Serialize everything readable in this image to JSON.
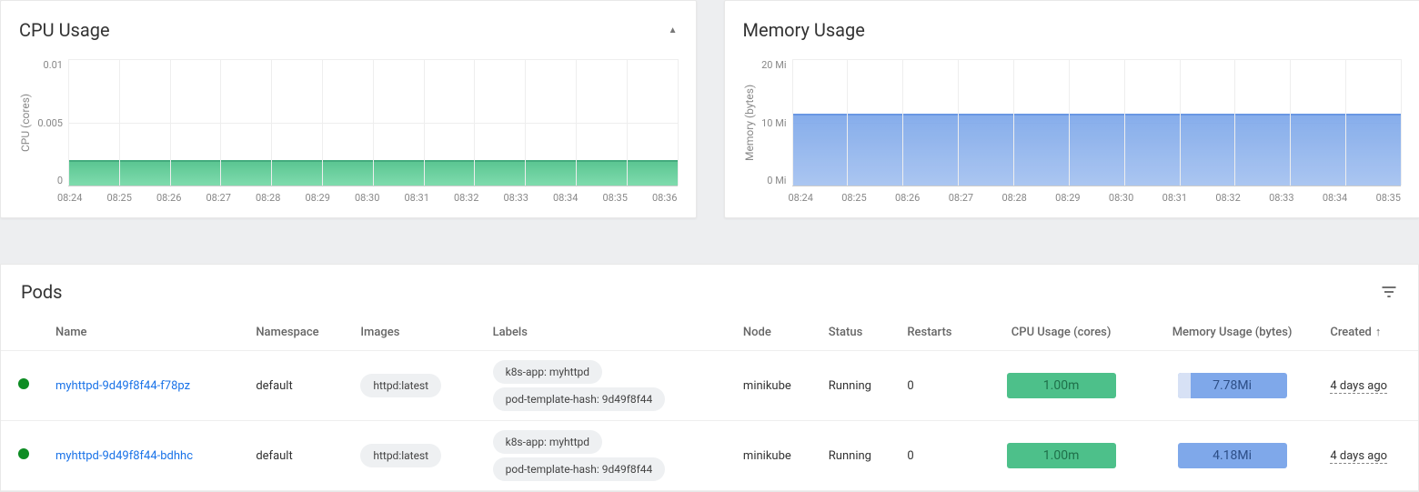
{
  "cpu_chart": {
    "title": "CPU Usage",
    "ylabel": "CPU (cores)",
    "yticks": [
      "0.01",
      "0.005",
      "0"
    ],
    "xticks": [
      "08:24",
      "08:25",
      "08:26",
      "08:27",
      "08:28",
      "08:29",
      "08:30",
      "08:31",
      "08:32",
      "08:33",
      "08:34",
      "08:35",
      "08:36"
    ]
  },
  "mem_chart": {
    "title": "Memory Usage",
    "ylabel": "Memory (bytes)",
    "yticks": [
      "20 Mi",
      "10 Mi",
      "0 Mi"
    ],
    "xticks": [
      "08:24",
      "08:25",
      "08:26",
      "08:27",
      "08:28",
      "08:29",
      "08:30",
      "08:31",
      "08:32",
      "08:33",
      "08:34",
      "08:35"
    ]
  },
  "chart_data": [
    {
      "type": "area",
      "title": "CPU Usage",
      "xlabel": "",
      "ylabel": "CPU (cores)",
      "ylim": [
        0,
        0.01
      ],
      "x": [
        "08:24",
        "08:25",
        "08:26",
        "08:27",
        "08:28",
        "08:29",
        "08:30",
        "08:31",
        "08:32",
        "08:33",
        "08:34",
        "08:35",
        "08:36"
      ],
      "series": [
        {
          "name": "CPU",
          "values": [
            0.002,
            0.002,
            0.002,
            0.002,
            0.002,
            0.002,
            0.002,
            0.002,
            0.002,
            0.002,
            0.002,
            0.002,
            0.002
          ]
        }
      ]
    },
    {
      "type": "area",
      "title": "Memory Usage",
      "xlabel": "",
      "ylabel": "Memory (bytes)",
      "ylim": [
        0,
        20
      ],
      "y_unit": "Mi",
      "x": [
        "08:24",
        "08:25",
        "08:26",
        "08:27",
        "08:28",
        "08:29",
        "08:30",
        "08:31",
        "08:32",
        "08:33",
        "08:34",
        "08:35"
      ],
      "series": [
        {
          "name": "Memory",
          "values": [
            12,
            12,
            12,
            12,
            12,
            12,
            11.9,
            11.8,
            11.8,
            11.8,
            11.8,
            11.8
          ]
        }
      ]
    }
  ],
  "pods": {
    "title": "Pods",
    "columns": {
      "name": "Name",
      "namespace": "Namespace",
      "images": "Images",
      "labels": "Labels",
      "node": "Node",
      "status": "Status",
      "restarts": "Restarts",
      "cpu": "CPU Usage (cores)",
      "mem": "Memory Usage (bytes)",
      "created": "Created"
    },
    "sort_indicator": "↑",
    "rows": [
      {
        "name": "myhttpd-9d49f8f44-f78pz",
        "namespace": "default",
        "image": "httpd:latest",
        "label1": "k8s-app: myhttpd",
        "label2": "pod-template-hash: 9d49f8f44",
        "node": "minikube",
        "status": "Running",
        "restarts": "0",
        "cpu": "1.00m",
        "mem": "7.78Mi",
        "mem_overlay_pct": 12,
        "created": "4 days ago"
      },
      {
        "name": "myhttpd-9d49f8f44-bdhhc",
        "namespace": "default",
        "image": "httpd:latest",
        "label1": "k8s-app: myhttpd",
        "label2": "pod-template-hash: 9d49f8f44",
        "node": "minikube",
        "status": "Running",
        "restarts": "0",
        "cpu": "1.00m",
        "mem": "4.18Mi",
        "mem_overlay_pct": 0,
        "created": "4 days ago"
      }
    ]
  }
}
